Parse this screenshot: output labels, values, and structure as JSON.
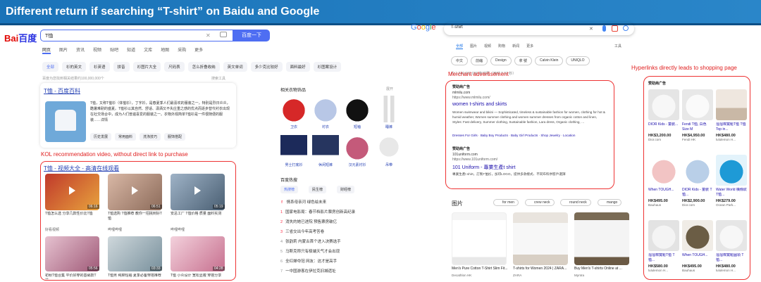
{
  "banner": {
    "title": "Different return if searching “T-shirt” on Baidu and Google"
  },
  "baidu": {
    "logo_a": "Bai",
    "logo_b": "百度",
    "query": "T恤",
    "search_button": "百度一下",
    "tabs": [
      "网页",
      "图片",
      "资讯",
      "视频",
      "贴吧",
      "知道",
      "文库",
      "地图",
      "采购",
      "更多"
    ],
    "chips": [
      "全部",
      "衫的英文",
      "衫英语",
      "拼音",
      "衫图片大全",
      "尺码表",
      "怎么折叠收纳",
      "英文单词",
      "多少克比较好",
      "面料最好",
      "衫图案设计"
    ],
    "result_count": "百度为您找到相关结果约100,000,000个",
    "filter": "搜索工具",
    "baike_title": "T恤 - 百度百科",
    "baike_desc": "T恤，又称T恤衫（体恤衫），丁字衫，是春夏季人们最喜欢的服装之一，特别是烈日炎炎，酷暑难耐的盛夏。T恤衫以其自然、舒适、潇洒又不失庄重之感的优点而逐步替代衬衣出现在社交场合中，成为人们普遍喜爱的服装之一。衣物外观简单T恤衫是一件很随便的服装……详情",
    "baike_pills": [
      "历史发展",
      "常用面料",
      "洗涤技巧",
      "服饰搭配"
    ],
    "kol_note": "KOL recommendation video, without direct link to purchase",
    "video_title": "T恤 - 视频大全 - 高清在线观看",
    "videos": [
      {
        "caption": "T恤怎么选 分享几款性价比T恤",
        "source": "好看视频",
        "duration": "06:16"
      },
      {
        "caption": "T恤选购 T恤推荐 教你一招挑到好T恤",
        "source": "哔哩哔哩",
        "duration": "06:51"
      },
      {
        "caption": "安总工厂 T恤价格 质量 面料实测",
        "source": "哔哩哔哩",
        "duration": "05:19"
      },
      {
        "caption": "初秋T恤合集 平价好穿的基础款T恤",
        "source": "哔哩哔哩",
        "duration": "05:56"
      },
      {
        "caption": "T恤男 纯棉短袖 夏季必备穿搭推荐",
        "source": "哔哩哔哩",
        "duration": "03:33"
      },
      {
        "caption": "T恤 小众设计 宽松显瘦 穿搭分享",
        "source": "哔哩哔哩",
        "duration": "04:28"
      }
    ],
    "related_title": "相关衣物饰品",
    "related_more": "展开",
    "related": [
      "卫衣",
      "衬衣",
      "短袖",
      "睡裤",
      "男士打底衫",
      "休闲短裤",
      "汉元素衬衫",
      "吊带"
    ],
    "hot_title": "百度热搜",
    "hot_tabs": [
      "热搜榜",
      "民生榜",
      "财经榜"
    ],
    "hot_items": [
      "情系母亲河 绿色绘未来",
      "国家电影局：春节档影片票房创新高纪录",
      "消失的她已进院 预售票房破亿",
      "三省交出今年高考答卷",
      "张韵莉 内蒙古首个进入决赛选手",
      "马斯克称只有极端天气才会出现",
      "全红婵夺冠 网友：这才是高手",
      "一中国游客在伊拉克旧城遗址"
    ]
  },
  "google": {
    "query": "T-shirt",
    "tabs": [
      "全部",
      "图片",
      "视频",
      "购物",
      "新闻",
      "更多"
    ],
    "tools": "工具",
    "chips": [
      "中文",
      "前縮",
      "Design",
      "拿 號",
      "Calvin Klein",
      "UNIQLO"
    ],
    "count": "约 1,240,000,000 条结果（用时 0.52 秒）",
    "merchant_note": "Merchant advertisement",
    "ad_label": "赞助商广告",
    "ads": [
      {
        "url": "mlmilu.com",
        "url2": "https://www.mlmilu.com/",
        "title": "women t-shirts and skirts",
        "desc": "Women swimwear and bikini — Sophisticated, timeless & sustainable fashion for women, clothing for hot & humid weather, Women summer clothing and women summer dresses from organic cotton and linen, Styles: Fast delivery, Summer clothing, Sustainable fashion, Lara dress, Organic clothing, …",
        "links": "Dresses For Girls · Baby Boy Products · Baby Girl Products · Shop Jewelry · Location"
      },
      {
        "url": "101uniform.com",
        "url2": "https://www.101uniform.com/",
        "title": "101 Uniform - 專業生產t shirt",
        "desc": "專業生產t shirt，訂製T恤衫，加印LOGO，提供多款樣式、不同布料供客戶選擇",
        "links": ""
      }
    ],
    "images_label": "图片",
    "image_chips": [
      "for men",
      "crew neck",
      "round neck",
      "mango"
    ],
    "images": [
      {
        "caption": "Men's Pure Cotton T-Shirt Slim Fit...",
        "source": "Decathlon HK"
      },
      {
        "caption": "T-shirts for Women 2024 | ZARA...",
        "source": "ZARA"
      },
      {
        "caption": "Buy Men's T-shirts Online at ...",
        "source": "Myntra"
      }
    ],
    "hyperlink_note": "Hyperlinks directly leads to shopping page",
    "shop_label": "赞助商广告",
    "shop_items": [
      {
        "name": "DIOR Kids - 童裝...",
        "price": "HK$3,200.00",
        "store": "Dior.com"
      },
      {
        "name": "Fendi T恤, 白色 Size M",
        "price": "HK$4,950.00",
        "store": "Fendi HK"
      },
      {
        "name": "溜溜棉寬鬆T恤 T恤 Top in...",
        "price": "HK$480.00",
        "store": "lululemon H..."
      },
      {
        "name": "When TOUGH...",
        "price": "HK$495.00",
        "store": "Bauhaus"
      },
      {
        "name": "DIOR Kids - 童裝 T恤...",
        "price": "HK$2,900.00",
        "store": "Dior.com"
      },
      {
        "name": "Water World 橫條紋T恤...",
        "price": "HK$279.00",
        "store": "Ocean Park..."
      },
      {
        "name": "溜溜棉寬鬆T恤 T恤...",
        "price": "HK$580.00",
        "store": "lululemon H..."
      },
      {
        "name": "When TOUGH...",
        "price": "HK$495.00",
        "store": "Bauhaus"
      },
      {
        "name": "溜溜棉寬鬆圓領 T恤...",
        "price": "HK$480.00",
        "store": "lululemon H..."
      }
    ]
  }
}
